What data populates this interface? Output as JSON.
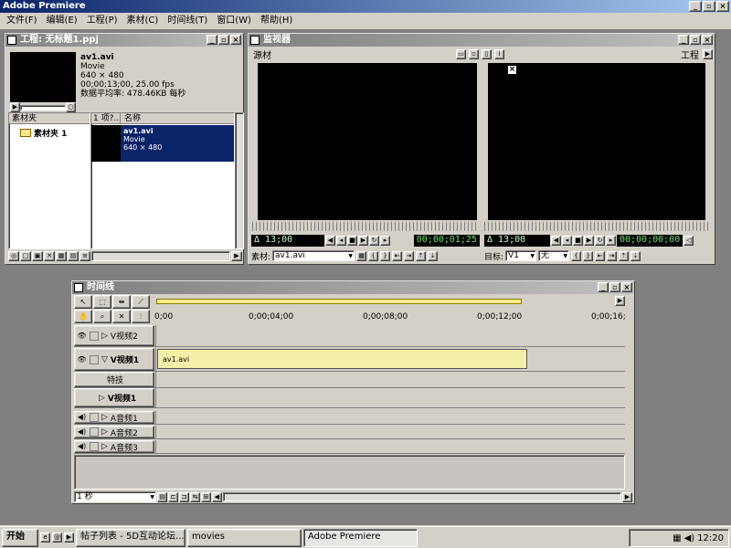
{
  "app": {
    "title": "Adobe Premiere",
    "min": "_",
    "restore": "▫",
    "close": "×"
  },
  "menu": [
    "文件(F)",
    "编辑(E)",
    "工程(P)",
    "素材(C)",
    "时间线(T)",
    "窗口(W)",
    "帮助(H)"
  ],
  "project": {
    "title": "工程: 无标题1.ppj",
    "clip_name": "av1.avi",
    "clip_type": "Movie",
    "clip_size": "640 × 480",
    "clip_duration": "00;00;13;00, 25.00 fps",
    "clip_rate": "数据平均率: 478.46KB 每秒",
    "bins_header": "素材夹",
    "bin_name": "素材夹 1",
    "items_count_header": "1 项?..",
    "name_header": "名称",
    "item_name": "av1.avi",
    "item_type": "Movie",
    "item_size": "640 × 480",
    "toolbar_icons": [
      "binoculars-icon",
      "folder-icon",
      "new-bin-icon",
      "delete-icon",
      "icon-view-icon",
      "thumbnail-view-icon",
      "list-view-icon",
      "scroll-left-icon"
    ]
  },
  "monitor": {
    "title": "监视器",
    "source_label": "源材",
    "program_label": "工程",
    "source_duration": "Δ 13;00",
    "source_timecode": "00;00;01;25",
    "program_duration": "Δ 13;00",
    "program_timecode": "00;00;00;00",
    "source_clip_label": "素材:",
    "source_clip_value": "av1.avi",
    "target_label": "目标:",
    "target_video": "V1",
    "target_audio": "无",
    "close_mark": "×"
  },
  "timeline": {
    "title": "时间线",
    "ruler_labels": [
      "0;00",
      "0;00;04;00",
      "0;00;08;00",
      "0;00;12;00",
      "0;00;16;"
    ],
    "tracks": [
      {
        "name": "V视频2"
      },
      {
        "name": "V视频1"
      },
      {
        "name": "特技"
      },
      {
        "name": "V视频1"
      },
      {
        "name": "A音频1"
      },
      {
        "name": "A音频2"
      },
      {
        "name": "A音频3"
      }
    ],
    "clip_label": "av1.avi",
    "zoom_value": "1 秒"
  },
  "taskbar": {
    "start": "开始",
    "tasks": [
      "帖子列表 - 5D互动论坛...",
      "movies",
      "Adobe Premiere"
    ],
    "clock": "12:20"
  }
}
